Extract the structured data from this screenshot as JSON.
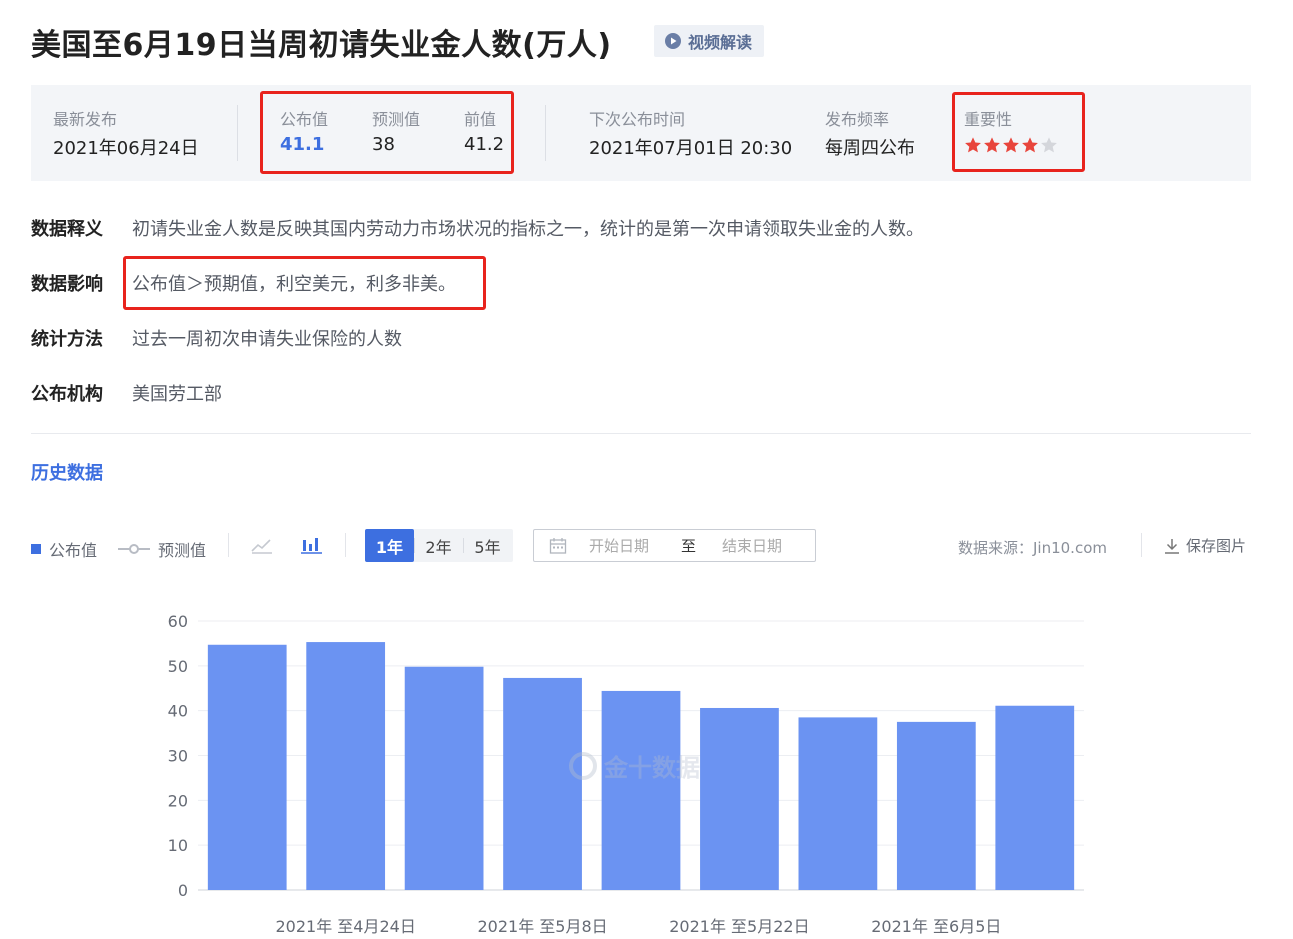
{
  "header": {
    "title": "美国至6月19日当周初请失业金人数(万人)",
    "video_label": "视频解读"
  },
  "info": {
    "latest_label": "最新发布",
    "latest_value": "2021年06月24日",
    "actual_label": "公布值",
    "actual_value": "41.1",
    "forecast_label": "预测值",
    "forecast_value": "38",
    "previous_label": "前值",
    "previous_value": "41.2",
    "next_label": "下次公布时间",
    "next_value": "2021年07月01日 20:30",
    "freq_label": "发布频率",
    "freq_value": "每周四公布",
    "importance_label": "重要性",
    "importance_stars": 4,
    "importance_max": 5
  },
  "details": [
    {
      "key": "数据释义",
      "value": "初请失业金人数是反映其国内劳动力市场状况的指标之一，统计的是第一次申请领取失业金的人数。"
    },
    {
      "key": "数据影响",
      "value": "公布值＞预期值，利空美元，利多非美。"
    },
    {
      "key": "统计方法",
      "value": "过去一周初次申请失业保险的人数"
    },
    {
      "key": "公布机构",
      "value": "美国劳工部"
    }
  ],
  "history": {
    "title": "历史数据",
    "legend_actual": "公布值",
    "legend_forecast": "预测值",
    "periods": [
      "1年",
      "2年",
      "5年"
    ],
    "active_period": "1年",
    "start_placeholder": "开始日期",
    "range_separator": "至",
    "end_placeholder": "结束日期",
    "source": "数据来源：Jin10.com",
    "save_label": "保存图片",
    "watermark": "金十数据"
  },
  "colors": {
    "accent": "#3d6fe0",
    "bar": "#6b93f2",
    "highlight_box": "#e8231d",
    "star_on": "#e8453c",
    "star_off": "#d4d6db"
  },
  "chart_data": {
    "type": "bar",
    "categories": [
      "",
      "2021年 至4月24日",
      "",
      "2021年 至5月8日",
      "",
      "2021年 至5月22日",
      "",
      "2021年 至6月5日",
      ""
    ],
    "series": [
      {
        "values": [
          54.7,
          55.3,
          49.8,
          47.3,
          44.4,
          40.6,
          38.5,
          37.5,
          41.1
        ]
      }
    ],
    "ylim": [
      0,
      60
    ],
    "yticks": [
      0,
      10,
      20,
      30,
      40,
      50,
      60
    ],
    "grid": true
  }
}
